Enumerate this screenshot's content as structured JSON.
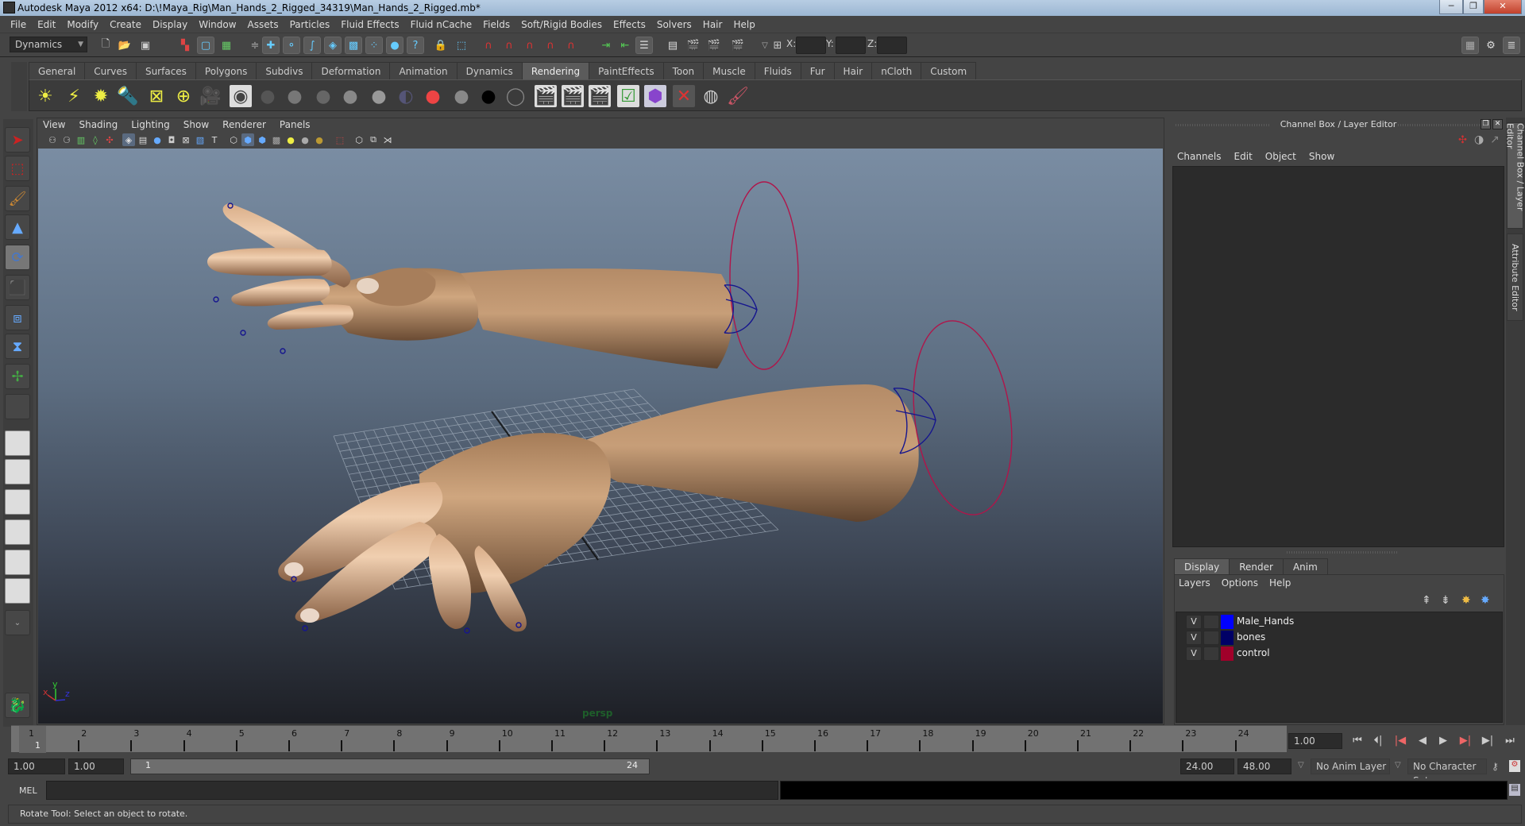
{
  "window": {
    "title": "Autodesk Maya 2012 x64: D:\\!Maya_Rig\\Man_Hands_2_Rigged_34319\\Man_Hands_2_Rigged.mb*",
    "minimize": "─",
    "maximize": "❐",
    "close": "✕"
  },
  "menubar": [
    "File",
    "Edit",
    "Modify",
    "Create",
    "Display",
    "Window",
    "Assets",
    "Particles",
    "Fluid Effects",
    "Fluid nCache",
    "Fields",
    "Soft/Rigid Bodies",
    "Effects",
    "Solvers",
    "Hair",
    "Help"
  ],
  "statusline": {
    "menuset": "Dynamics",
    "x_label": "X:",
    "y_label": "Y:",
    "z_label": "Z:",
    "x_value": "",
    "y_value": "",
    "z_value": ""
  },
  "shelf": {
    "tabs": [
      "General",
      "Curves",
      "Surfaces",
      "Polygons",
      "Subdivs",
      "Deformation",
      "Animation",
      "Dynamics",
      "Rendering",
      "PaintEffects",
      "Toon",
      "Muscle",
      "Fluids",
      "Fur",
      "Hair",
      "nCloth",
      "Custom"
    ],
    "active_tab": "Rendering",
    "icons": [
      "ambient-light",
      "directional-light",
      "point-light",
      "spot-light",
      "area-light",
      "volume-light",
      "camera",
      "render-view",
      "blinn-material",
      "lambert-material",
      "phong-material",
      "phonge-material",
      "anisotropic-material",
      "ramp-shader",
      "layered-shader",
      "surface-shader-gray",
      "surface-shader-black",
      "use-background",
      "render-current-frame",
      "ipr-render",
      "batch-render",
      "render-settings",
      "hypershade",
      "hypershade-delete",
      "render-preview",
      "paint-canvas"
    ]
  },
  "viewport": {
    "menus": [
      "View",
      "Shading",
      "Lighting",
      "Show",
      "Renderer",
      "Panels"
    ],
    "camera_label": "persp",
    "axis": {
      "x": "x",
      "y": "y",
      "z": "z"
    },
    "colors": {
      "skin": "#c29872",
      "control_curve": "#b0154a",
      "bone": "#14148c"
    }
  },
  "channel_box": {
    "title": "Channel Box / Layer Editor",
    "menus": [
      "Channels",
      "Edit",
      "Object",
      "Show"
    ]
  },
  "side_tabs": [
    "Channel Box / Layer Editor",
    "Attribute Editor"
  ],
  "layer_editor": {
    "tabs": [
      "Display",
      "Render",
      "Anim"
    ],
    "active_tab": "Display",
    "menus": [
      "Layers",
      "Options",
      "Help"
    ],
    "layers": [
      {
        "visible": "V",
        "name": "Male_Hands",
        "color": "#0000ff"
      },
      {
        "visible": "V",
        "name": "bones",
        "color": "#000066"
      },
      {
        "visible": "V",
        "name": "control",
        "color": "#a0002a"
      }
    ]
  },
  "timeline": {
    "frames": [
      "1",
      "2",
      "3",
      "4",
      "5",
      "6",
      "7",
      "8",
      "9",
      "10",
      "11",
      "12",
      "13",
      "14",
      "15",
      "16",
      "17",
      "18",
      "19",
      "20",
      "21",
      "22",
      "23",
      "24"
    ],
    "current_frame_marker": "1",
    "current_time": "1.00",
    "playback": [
      "go-to-start",
      "step-back-frame",
      "step-back-key",
      "play-backwards",
      "play-forwards",
      "step-forward-key",
      "step-forward-frame",
      "go-to-end"
    ]
  },
  "range": {
    "start_time": "1.00",
    "playback_start": "1.00",
    "range_start_label": "1",
    "range_end_label": "24",
    "playback_end": "24.00",
    "end_time": "48.00",
    "anim_layer": "No Anim Layer",
    "character_set": "No Character Set"
  },
  "command_line": {
    "label": "MEL",
    "value": ""
  },
  "help_line": "Rotate Tool: Select an object to rotate."
}
